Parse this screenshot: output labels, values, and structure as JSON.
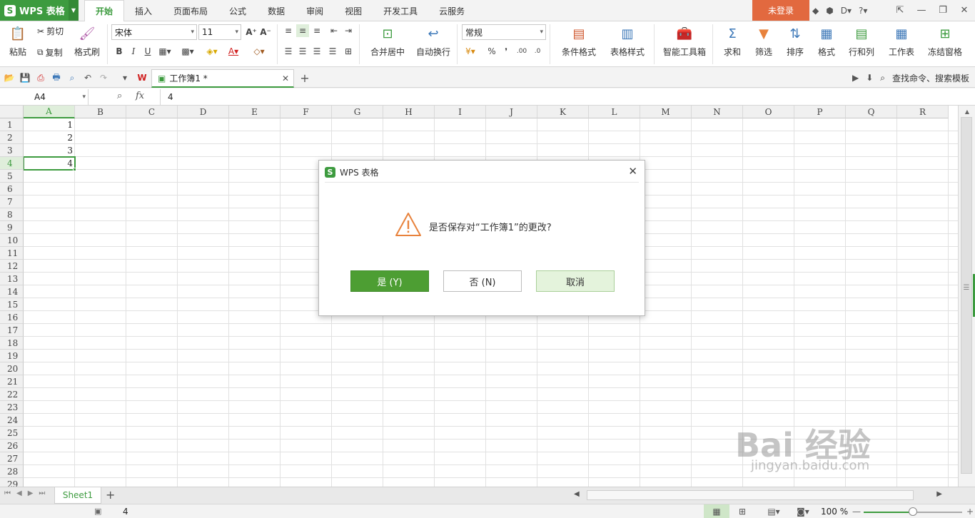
{
  "app": {
    "name": "WPS 表格",
    "logo_letter": "S"
  },
  "menu_tabs": [
    "开始",
    "插入",
    "页面布局",
    "公式",
    "数据",
    "审阅",
    "视图",
    "开发工具",
    "云服务"
  ],
  "active_tab": "开始",
  "login_label": "未登录",
  "ribbon": {
    "paste": "粘贴",
    "cut": "剪切",
    "copy": "复制",
    "format_painter": "格式刷",
    "font_name": "宋体",
    "font_size": "11",
    "bold": "B",
    "italic": "I",
    "underline": "U",
    "merge_center": "合并居中",
    "wrap_text": "自动换行",
    "number_format": "常规",
    "percent": "%",
    "comma": "❜",
    "cond_format": "条件格式",
    "table_style": "表格样式",
    "smart_toolbox": "智能工具箱",
    "sum": "求和",
    "filter": "筛选",
    "sort": "排序",
    "format": "格式",
    "row_col": "行和列",
    "worksheet": "工作表",
    "freeze": "冻结窗格"
  },
  "document_tab": "工作簿1 *",
  "search_commands": "查找命令、搜索模板",
  "formula_bar": {
    "name_box": "A4",
    "fx": "fx",
    "value": "4"
  },
  "columns": [
    "A",
    "B",
    "C",
    "D",
    "E",
    "F",
    "G",
    "H",
    "I",
    "J",
    "K",
    "L",
    "M",
    "N",
    "O",
    "P",
    "Q",
    "R"
  ],
  "rows": [
    "1",
    "2",
    "3",
    "4",
    "5",
    "6",
    "7",
    "8",
    "9",
    "10",
    "11",
    "12",
    "13",
    "14",
    "15",
    "16",
    "17",
    "18",
    "19",
    "20",
    "21",
    "22",
    "23",
    "24",
    "25",
    "26",
    "27",
    "28",
    "29"
  ],
  "cells": {
    "A1": "1",
    "A2": "2",
    "A3": "3",
    "A4": "4"
  },
  "selected_cell": "A4",
  "sheet_tabs": [
    "Sheet1"
  ],
  "status": {
    "value": "4",
    "zoom": "100 %",
    "zoom_level": 0.5
  },
  "dialog": {
    "title": "WPS 表格",
    "message": "是否保存对“工作簿1”的更改?",
    "yes": "是 (Y)",
    "no": "否 (N)",
    "cancel": "取消"
  },
  "watermark": {
    "main": "Bai 经验",
    "sub": "jingyan.baidu.com"
  },
  "colors": {
    "accent": "#3d9b3f",
    "login": "#e2693f",
    "warning": "#e8823c"
  }
}
